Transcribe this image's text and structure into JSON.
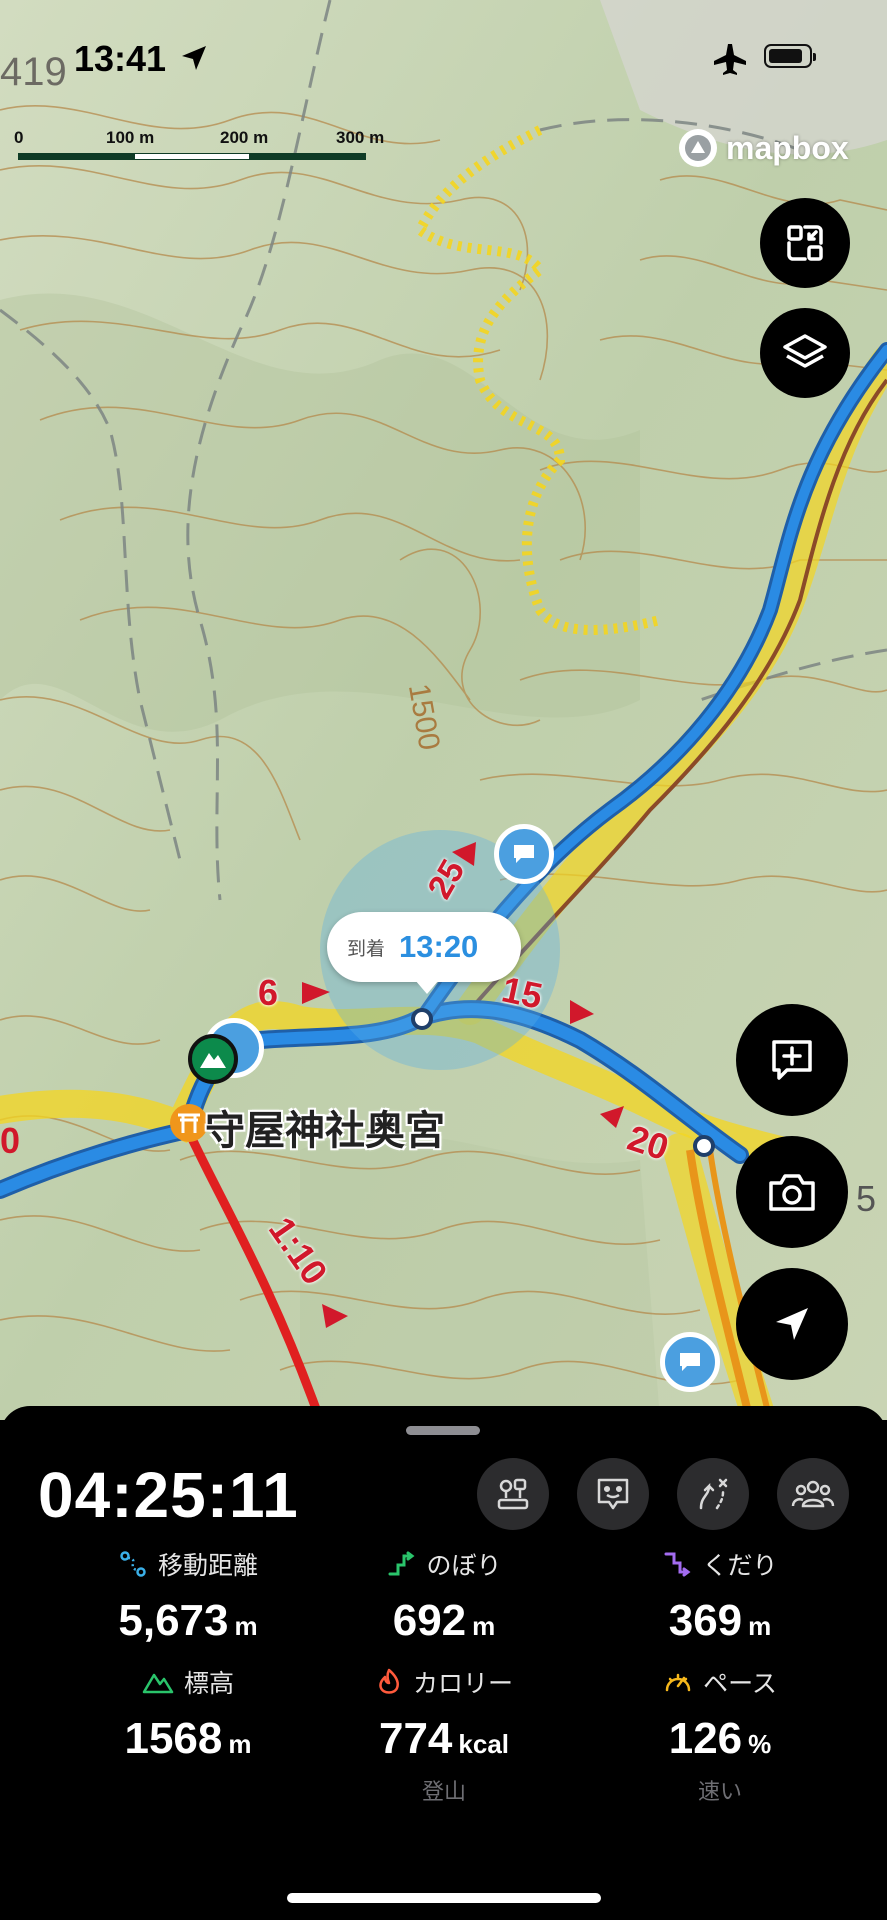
{
  "status_bar": {
    "time": "13:41"
  },
  "map": {
    "scale_labels": [
      "0",
      "100 m",
      "200 m",
      "300 m"
    ],
    "attribution": "mapbox",
    "contour_label": "1500",
    "stray_labels": [
      "419",
      "0",
      "5"
    ],
    "course_markers": [
      "6",
      "15",
      "20",
      "25",
      "1:10"
    ],
    "callout": {
      "label": "到着",
      "time": "13:20"
    },
    "place_name": "守屋神社奥宮",
    "colors": {
      "route": "#2a8be4",
      "highlight": "#f4d51f",
      "red_route": "#e02020",
      "orange_route": "#e8951a"
    }
  },
  "map_controls": {
    "top": [
      "collapse-icon",
      "layers-icon"
    ],
    "bottom": [
      "add-memo-icon",
      "camera-icon",
      "navigation-arrow-icon"
    ]
  },
  "panel": {
    "elapsed": "04:25:11",
    "tools": [
      "map-pins-icon",
      "face-icon",
      "route-icon",
      "group-icon"
    ],
    "stats": [
      {
        "label": "移動距離",
        "value": "5,673",
        "unit": "m",
        "icon": "distance-icon",
        "color": "#3bb0e8"
      },
      {
        "label": "のぼり",
        "value": "692",
        "unit": "m",
        "icon": "ascent-icon",
        "color": "#2ac46b"
      },
      {
        "label": "くだり",
        "value": "369",
        "unit": "m",
        "icon": "descent-icon",
        "color": "#a36cf0"
      },
      {
        "label": "標高",
        "value": "1568",
        "unit": "m",
        "icon": "mountain-icon",
        "color": "#2ac46b"
      },
      {
        "label": "カロリー",
        "value": "774",
        "unit": "kcal",
        "icon": "flame-icon",
        "color": "#ff5a3c",
        "sub": "登山"
      },
      {
        "label": "ペース",
        "value": "126",
        "unit": "%",
        "icon": "speedometer-icon",
        "color": "#f6b81c",
        "sub": "速い"
      }
    ]
  }
}
